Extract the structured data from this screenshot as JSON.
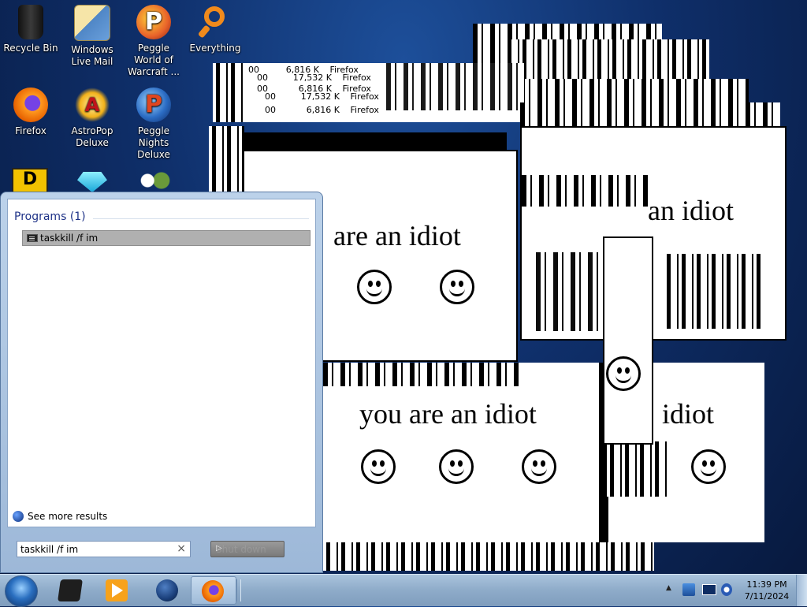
{
  "desktop": {
    "icons": [
      {
        "label": "Recycle Bin",
        "icon": "recycle-bin-icon",
        "color": "#2b2b2b"
      },
      {
        "label": "Windows Live Mail",
        "icon": "mail-icon",
        "color": "#4f86c6"
      },
      {
        "label": "Peggle World of Warcraft ...",
        "icon": "peggle-wow-icon",
        "color": "#e8622a"
      },
      {
        "label": "Everything",
        "icon": "magnifier-icon",
        "color": "#f08a1c"
      },
      {
        "label": "Firefox",
        "icon": "firefox-icon",
        "color": "#e66000"
      },
      {
        "label": "AstroPop Deluxe",
        "icon": "astropop-icon",
        "color": "#f2b11a"
      },
      {
        "label": "Peggle Nights Deluxe",
        "icon": "peggle-nights-icon",
        "color": "#d6461f"
      }
    ]
  },
  "popups": {
    "message": "you are an idiot",
    "message_partial": "are an idiot",
    "message_end": "an idiot",
    "message_tail": "idiot"
  },
  "task_manager": {
    "rows": [
      {
        "col1": "00",
        "mem": "6,816 K",
        "name": "Firefox"
      },
      {
        "col1": "00",
        "mem": "17,532 K",
        "name": "Firefox"
      },
      {
        "col1": "00",
        "mem": "6,816 K",
        "name": "Firefox"
      },
      {
        "col1": "00",
        "mem": "17,532 K",
        "name": "Firefox"
      },
      {
        "col1": "00",
        "mem": "6,816 K",
        "name": "Firefox"
      }
    ]
  },
  "start_menu": {
    "section_header": "Programs (1)",
    "results": [
      {
        "label": "taskkill /f im",
        "icon": "command-prompt-icon"
      }
    ],
    "see_more": "See more results",
    "search_value": "taskkill /f im",
    "clear_glyph": "×",
    "shutdown_label": "Shut down",
    "shutdown_arrow": "▷"
  },
  "taskbar": {
    "pinned": [
      {
        "name": "explorer-icon",
        "color": "#1e1e1e"
      },
      {
        "name": "media-player-icon",
        "color": "#f7a21b"
      },
      {
        "name": "app-globe-icon",
        "color": "#1a3f7a"
      },
      {
        "name": "firefox-icon",
        "color": "#e66000"
      }
    ],
    "tray_arrow": "▲",
    "clock_time": "11:39 PM",
    "clock_date": "7/11/2024"
  },
  "colors": {
    "accent": "#1e3287",
    "taskbar": "#8eabc9",
    "selection": "#b0b0b0"
  }
}
